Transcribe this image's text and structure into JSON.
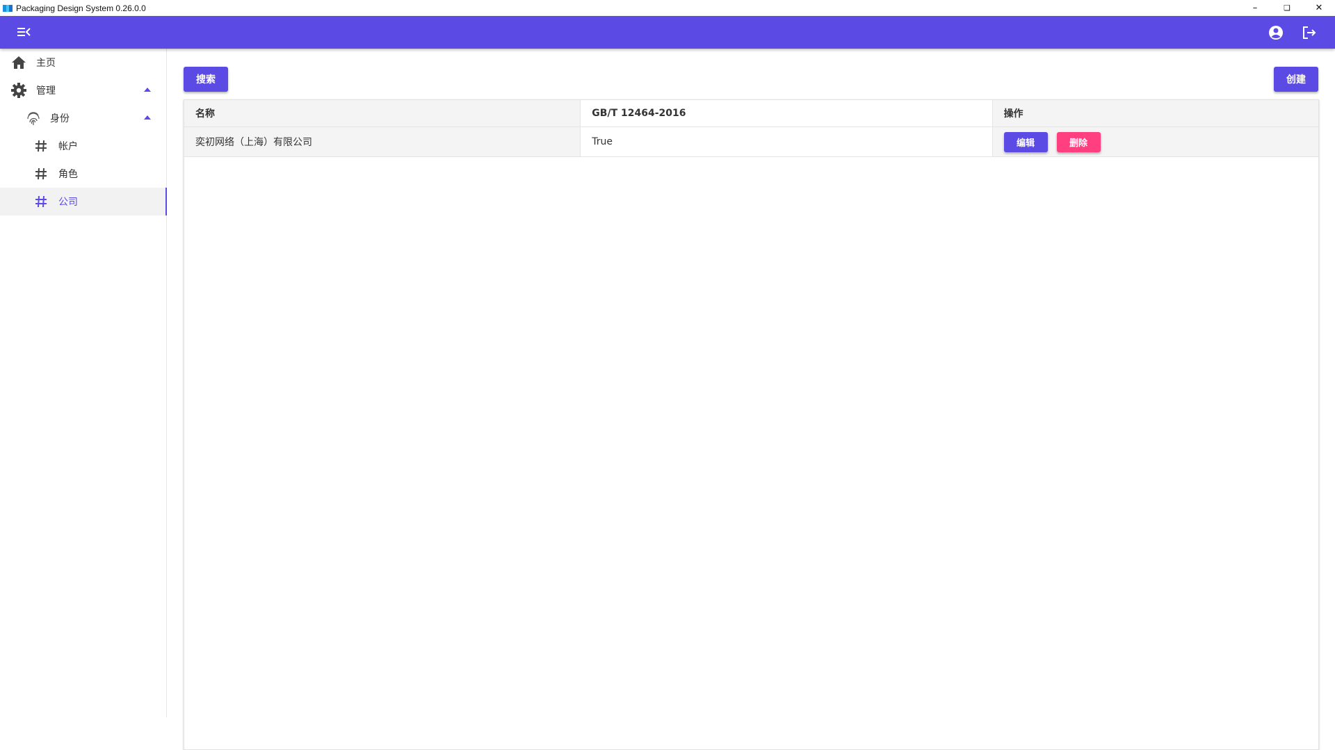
{
  "window": {
    "title": "Packaging Design System 0.26.0.0",
    "controls": {
      "minimize": "–",
      "restore": "❏",
      "close": "✕"
    }
  },
  "colors": {
    "primary": "#5c4ae4",
    "danger": "#ff3f80",
    "row_shade": "#f4f4f4"
  },
  "appbar": {
    "menu_icon": "menu-collapse-icon",
    "account_icon": "account-circle-icon",
    "logout_icon": "logout-icon"
  },
  "sidebar": {
    "items": [
      {
        "label": "主页",
        "icon": "home-icon"
      },
      {
        "label": "管理",
        "icon": "gear-icon",
        "expanded": true
      },
      {
        "label": "身份",
        "icon": "fingerprint-icon",
        "expanded": true
      },
      {
        "label": "帐户",
        "icon": "hash-icon"
      },
      {
        "label": "角色",
        "icon": "hash-icon"
      },
      {
        "label": "公司",
        "icon": "hash-icon",
        "active": true
      }
    ]
  },
  "toolbar": {
    "search_label": "搜索",
    "create_label": "创建"
  },
  "table": {
    "columns": [
      "名称",
      "GB/T 12464-2016",
      "操作"
    ],
    "rows": [
      {
        "name": "奕初网络（上海）有限公司",
        "gb": "True",
        "edit_label": "编辑",
        "delete_label": "删除"
      }
    ]
  }
}
